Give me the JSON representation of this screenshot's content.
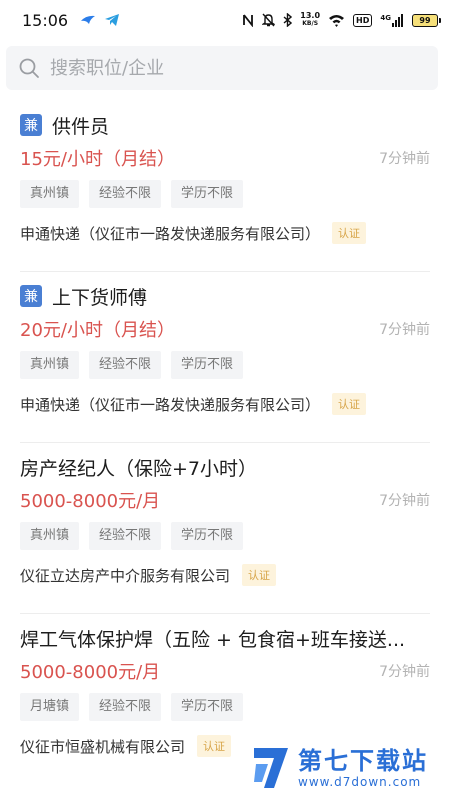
{
  "status_bar": {
    "time": "15:06",
    "net_speed_value": "13.0",
    "net_speed_unit": "KB/S",
    "hd_label": "HD",
    "signal_label": "4G",
    "battery_level": "99"
  },
  "search": {
    "placeholder": "搜索职位/企业"
  },
  "jobs": [
    {
      "badge": "兼",
      "title": "供件员",
      "salary": "15元/小时（月结）",
      "time": "7分钟前",
      "tags": [
        "真州镇",
        "经验不限",
        "学历不限"
      ],
      "company": "申通快递（仪征市一路发快递服务有限公司）",
      "verified": "认证"
    },
    {
      "badge": "兼",
      "title": "上下货师傅",
      "salary": "20元/小时（月结）",
      "time": "7分钟前",
      "tags": [
        "真州镇",
        "经验不限",
        "学历不限"
      ],
      "company": "申通快递（仪征市一路发快递服务有限公司）",
      "verified": "认证"
    },
    {
      "badge": "",
      "title": "房产经纪人（保险+7小时）",
      "salary": "5000-8000元/月",
      "time": "7分钟前",
      "tags": [
        "真州镇",
        "经验不限",
        "学历不限"
      ],
      "company": "仪征立达房产中介服务有限公司",
      "verified": "认证"
    },
    {
      "badge": "",
      "title": "焊工气体保护焊（五险 + 包食宿+班车接送...",
      "salary": "5000-8000元/月",
      "time": "7分钟前",
      "tags": [
        "月塘镇",
        "经验不限",
        "学历不限"
      ],
      "company": "仪征市恒盛机械有限公司",
      "verified": "认证"
    }
  ],
  "watermark": {
    "name": "第七下载站",
    "url": "www.d7down.com"
  },
  "colors": {
    "salary": "#d9534f",
    "badge_bg": "#4a7fd3",
    "verified_text": "#d7a448",
    "watermark": "#2a6fd6"
  }
}
